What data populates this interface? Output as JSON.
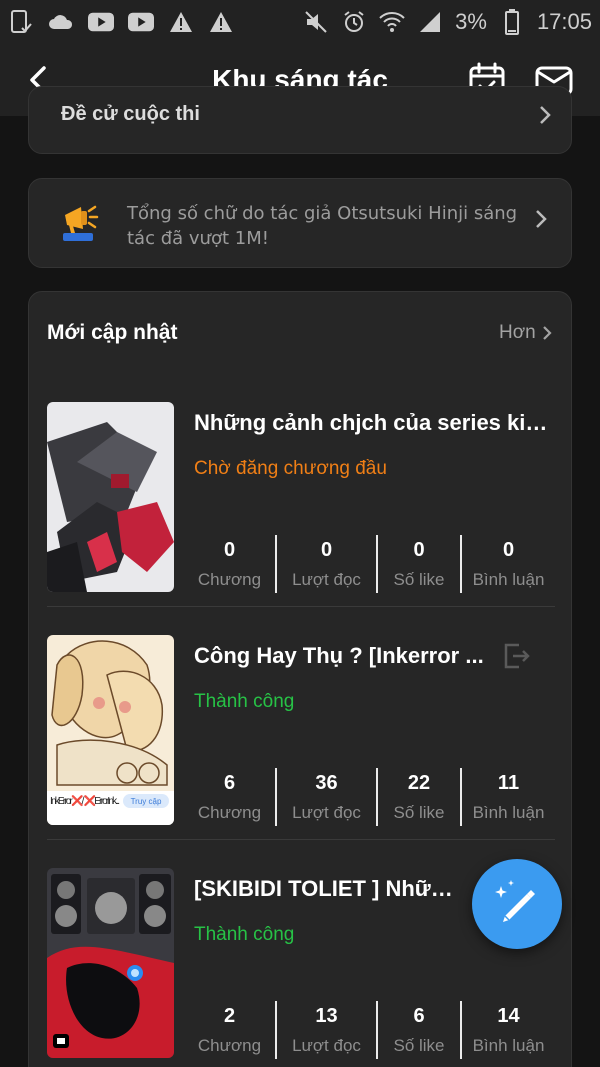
{
  "status_bar": {
    "left_icons": [
      "tablet-check-icon",
      "cloud-icon",
      "youtube-icon",
      "youtube-icon",
      "warning-icon",
      "warning-icon"
    ],
    "right_icons": [
      "mute-icon",
      "alarm-icon",
      "wifi-icon",
      "signal-icon"
    ],
    "battery": "3%",
    "time": "17:05"
  },
  "app_bar": {
    "title": "Khu sáng tác",
    "back_icon": "chevron-left-icon",
    "calendar_icon": "calendar-check-icon",
    "mail_icon": "mail-icon"
  },
  "top_card": {
    "label": "Đề cử cuộc thi"
  },
  "notice": {
    "icon": "megaphone-icon",
    "text": "Tổng số chữ do tác giả Otsutsuki Hinji sáng tác đã vượt 1M!"
  },
  "recent": {
    "title": "Mới cập nhật",
    "more_label": "Hơn",
    "stat_labels": [
      "Chương",
      "Lượt đọc",
      "Số like",
      "Bình luận"
    ],
    "stories": [
      {
        "title": "Những cảnh chjch của series kia ...",
        "status": "Chờ đăng chương đầu",
        "status_color": "#f07f16",
        "stats": [
          "0",
          "0",
          "0",
          "0"
        ]
      },
      {
        "title": "Công Hay Thụ ? [Inkerror ...",
        "status": "Thành công",
        "status_color": "#27c246",
        "stats": [
          "6",
          "36",
          "22",
          "11"
        ],
        "cover_caption": "InkError❌/ ❌ErrorInk...",
        "cover_tag": "Truy cập"
      },
      {
        "title": "[SKIBIDI TOLIET ] Những...",
        "status": "Thành công",
        "status_color": "#27c246",
        "stats": [
          "2",
          "13",
          "6",
          "14"
        ]
      }
    ]
  },
  "fab": {
    "icon": "pencil-sparkle-icon"
  }
}
